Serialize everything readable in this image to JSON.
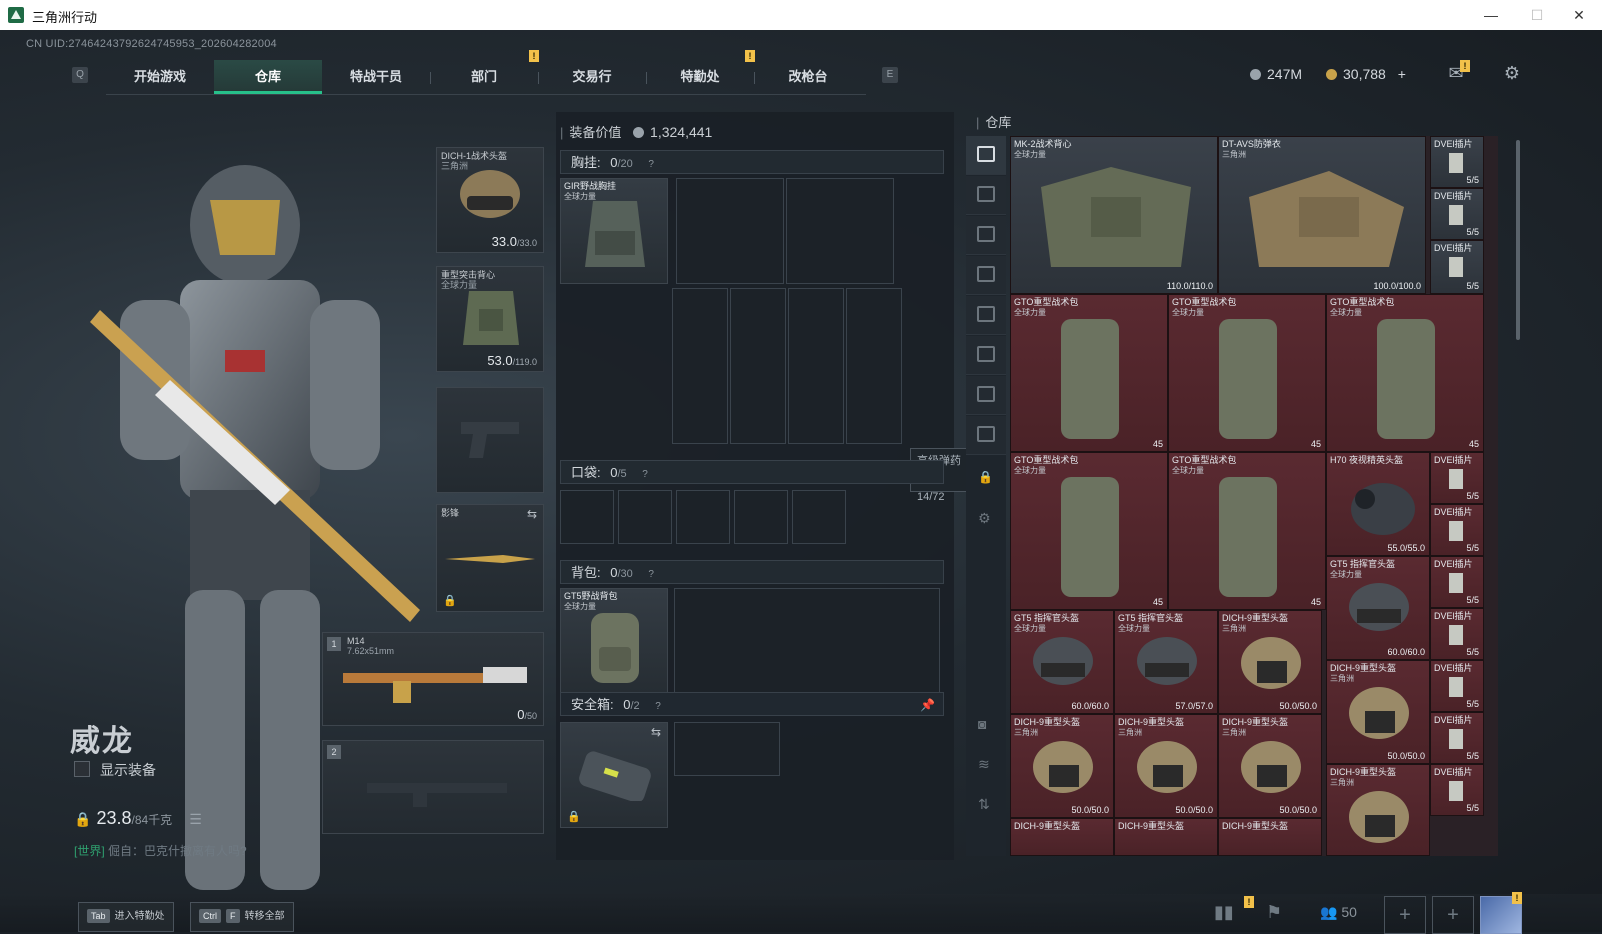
{
  "window": {
    "title": "三角洲行动",
    "minimize": "—",
    "maximize": "☐",
    "close": "✕"
  },
  "uid": "CN UID:27464243792624745953_202604282004",
  "nav": {
    "key_left": "Q",
    "key_right": "E",
    "tabs": [
      {
        "label": "开始游戏"
      },
      {
        "label": "仓库"
      },
      {
        "label": "特战干员"
      },
      {
        "label": "部门"
      },
      {
        "label": "交易行"
      },
      {
        "label": "特勤处"
      },
      {
        "label": "改枪台"
      }
    ],
    "active_tab": "仓库",
    "alert_mark": "!"
  },
  "currency": {
    "silver": "247M",
    "gold": "30,788",
    "add": "+"
  },
  "operator": {
    "name": "威龙",
    "show_equipment": "显示装备",
    "weight": "23.8",
    "weight_max": "/84千克",
    "chat_tag": "[世界]",
    "chat_text": "倔自：巴克什撤离有人吗?"
  },
  "equipment": {
    "helmet": {
      "name": "DICH-1战术头盔",
      "sub": "三角洲",
      "value": "33.0",
      "max": "/33.0"
    },
    "armor": {
      "name": "重型突击背心",
      "sub": "全球力量",
      "value": "53.0",
      "max": "/119.0"
    },
    "melee": {
      "name": "影锋"
    },
    "primary": {
      "slot": "1",
      "name": "M14",
      "ammo": "7.62x51mm",
      "count": "0",
      "max": "/50"
    },
    "secondary": {
      "slot": "2"
    }
  },
  "loadout": {
    "value_label": "装备价值",
    "value": "1,324,441",
    "chest": {
      "label": "胸挂:",
      "count": "0",
      "max": "/20",
      "item": "GIR野战胸挂",
      "item_sub": "全球力量"
    },
    "pocket": {
      "label": "口袋:",
      "count": "0",
      "max": "/5"
    },
    "backpack": {
      "label": "背包:",
      "count": "0",
      "max": "/30",
      "item": "GT5野战背包",
      "item_sub": "全球力量"
    },
    "safebox": {
      "label": "安全箱:",
      "count": "0",
      "max": "/2"
    },
    "help": "?"
  },
  "tooltip": {
    "name": "高级弹药箱",
    "count": "14/72"
  },
  "warehouse": {
    "title": "仓库",
    "items": [
      {
        "name": "MK-2战术背心",
        "sub": "全球力量",
        "val": "110.0/110.0"
      },
      {
        "name": "DT-AVS防弹衣",
        "sub": "三角洲",
        "val": "100.0/100.0"
      },
      {
        "name": "GTO重型战术包",
        "sub": "全球力量",
        "val": "45"
      },
      {
        "name": "GTO重型战术包",
        "sub": "全球力量",
        "val": "45"
      },
      {
        "name": "GTO重型战术包",
        "sub": "全球力量",
        "val": "45"
      },
      {
        "name": "GTO重型战术包",
        "sub": "全球力量",
        "val": "45"
      },
      {
        "name": "GTO重型战术包",
        "sub": "全球力量",
        "val": "45"
      },
      {
        "name": "H70 夜视精英头盔",
        "sub": "",
        "val": "55.0/55.0"
      },
      {
        "name": "GT5 指挥官头盔",
        "sub": "全球力量",
        "val": "60.0/60.0"
      },
      {
        "name": "GT5 指挥官头盔",
        "sub": "全球力量",
        "val": "60.0/60.0"
      },
      {
        "name": "GT5 指挥官头盔",
        "sub": "全球力量",
        "val": "57.0/57.0"
      },
      {
        "name": "DICH-9重型头盔",
        "sub": "三角洲",
        "val": "50.0/50.0"
      },
      {
        "name": "DICH-9重型头盔",
        "sub": "三角洲",
        "val": "50.0/50.0"
      },
      {
        "name": "DICH-9重型头盔",
        "sub": "三角洲",
        "val": "50.0/50.0"
      },
      {
        "name": "DICH-9重型头盔",
        "sub": "三角洲",
        "val": "50.0/50.0"
      },
      {
        "name": "DICH-9重型头盔",
        "sub": "三角洲",
        "val": "50.0/50.0"
      },
      {
        "name": "DICH-9重型头盔",
        "sub": "三角洲",
        "val": ""
      },
      {
        "name": "DICH-9重型头盔",
        "sub": "",
        "val": ""
      },
      {
        "name": "DICH-9重型头盔",
        "sub": "",
        "val": ""
      },
      {
        "name": "DICH-9重型头盔",
        "sub": "",
        "val": ""
      }
    ],
    "plate_name": "DVEl插片",
    "plate_count": "5/5"
  },
  "bottom": {
    "hint1_key": "Tab",
    "hint1_text": "进入特勤处",
    "hint2_key1": "Ctrl",
    "hint2_key2": "F",
    "hint2_text": "转移全部",
    "squad_count": "50",
    "add": "+"
  }
}
